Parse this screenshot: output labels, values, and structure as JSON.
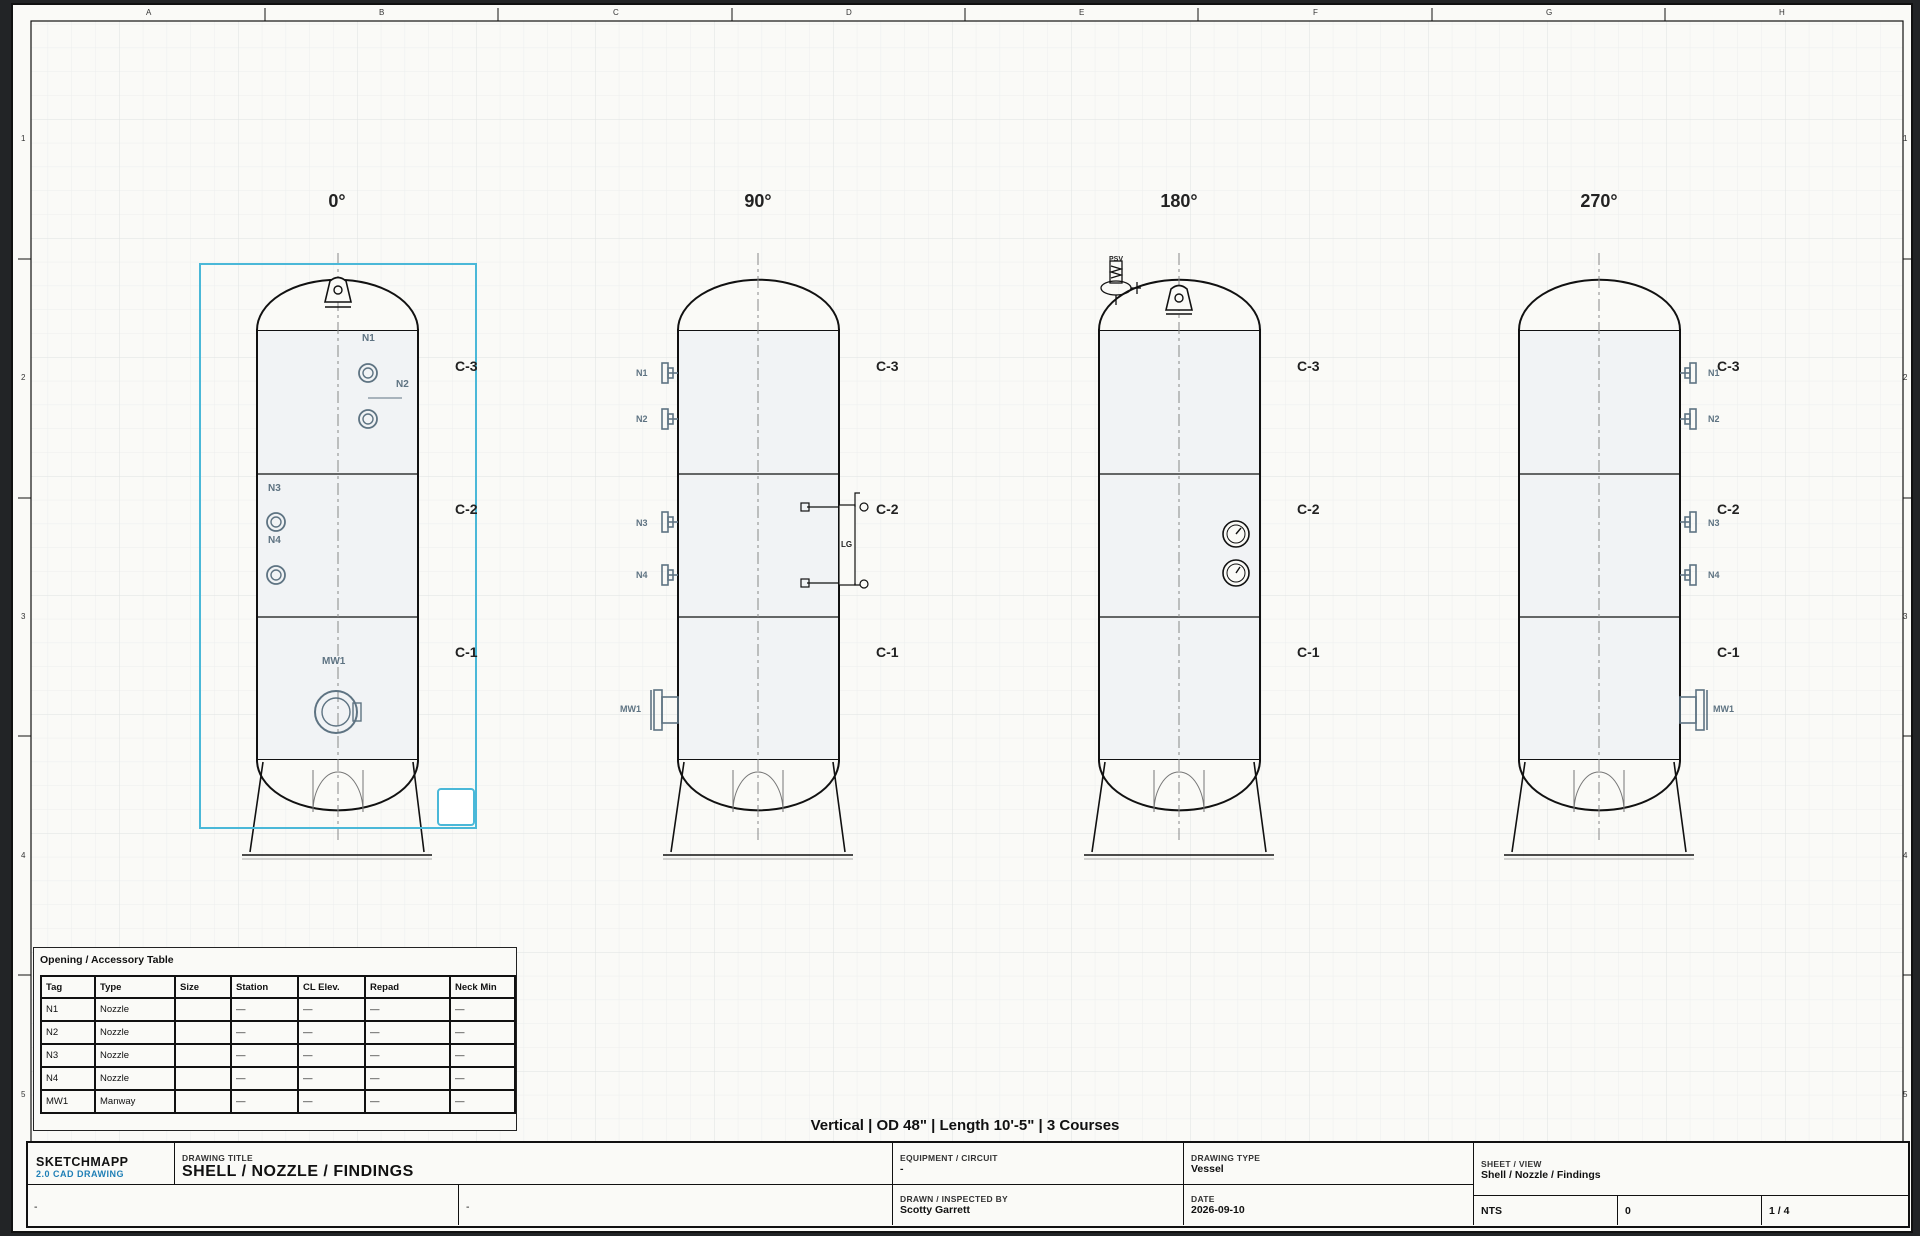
{
  "zones": {
    "columns": [
      "A",
      "B",
      "C",
      "D",
      "E",
      "F",
      "G",
      "H"
    ],
    "rows": [
      "1",
      "2",
      "3",
      "4",
      "5"
    ]
  },
  "views": [
    {
      "title": "0°"
    },
    {
      "title": "90°"
    },
    {
      "title": "180°"
    },
    {
      "title": "270°"
    }
  ],
  "courses": [
    "C-3",
    "C-2",
    "C-1"
  ],
  "tags": {
    "n1": "N1",
    "n2": "N2",
    "n3": "N3",
    "n4": "N4",
    "mw1": "MW1",
    "lg": "LG",
    "psv": "PSV"
  },
  "table": {
    "title": "Opening / Accessory Table",
    "headers": [
      "Tag",
      "Type",
      "Size",
      "Station",
      "CL Elev.",
      "Repad",
      "Neck Min"
    ],
    "rows": [
      [
        "N1",
        "Nozzle",
        "",
        "—",
        "—",
        "—",
        "—"
      ],
      [
        "N2",
        "Nozzle",
        "",
        "—",
        "—",
        "—",
        "—"
      ],
      [
        "N3",
        "Nozzle",
        "",
        "—",
        "—",
        "—",
        "—"
      ],
      [
        "N4",
        "Nozzle",
        "",
        "—",
        "—",
        "—",
        "—"
      ],
      [
        "MW1",
        "Manway",
        "",
        "—",
        "—",
        "—",
        "—"
      ]
    ]
  },
  "summary": "Vertical | OD 48\" | Length 10'-5\" | 3 Courses",
  "title_block": {
    "brand": "SKETCHMAPP",
    "brand_sub": "2.0 CAD DRAWING",
    "drawing_title_label": "DRAWING TITLE",
    "drawing_title": "SHELL / NOZZLE / FINDINGS",
    "equipment_label": "EQUIPMENT / CIRCUIT",
    "equipment": "-",
    "drawing_type_label": "DRAWING TYPE",
    "drawing_type": "Vessel",
    "sheet_view_label": "SHEET / VIEW",
    "sheet_view": "Shell / Nozzle / Findings",
    "drawn_label": "DRAWN / INSPECTED BY",
    "drawn": "Scotty Garrett",
    "date_label": "DATE",
    "date": "2026-09-10",
    "bottom_left_1": "-",
    "bottom_left_2": "-",
    "scale": "NTS",
    "revision": "0",
    "sheet_number": "1 / 4"
  },
  "colors": {
    "paper": "#fafaf7",
    "grid": "#e6e8e8",
    "ink": "#111111",
    "shell_fill": "#f1f3f5",
    "tag_color": "#5e7382",
    "selection": "#4ab8d8",
    "accent": "#1f7fb6"
  }
}
